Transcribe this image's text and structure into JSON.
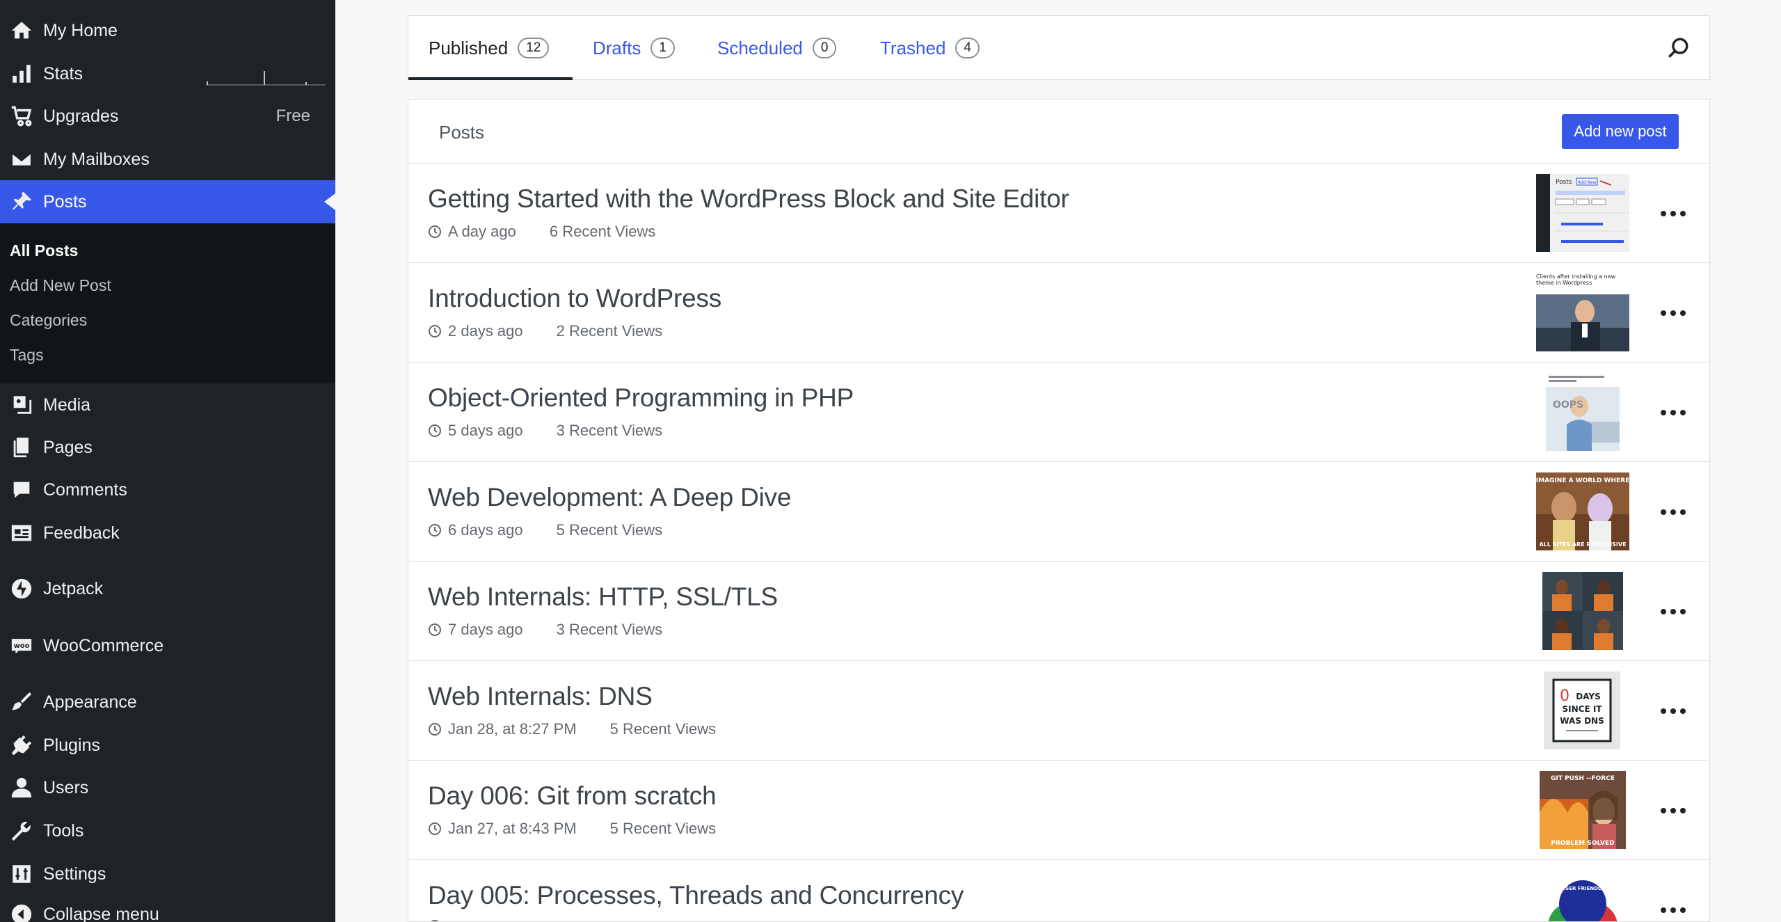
{
  "sidebar": {
    "menu": [
      {
        "label": "My Home",
        "icon": "home-icon"
      },
      {
        "label": "Stats",
        "icon": "stats-icon"
      },
      {
        "label": "Upgrades",
        "icon": "cart-icon",
        "badge": "Free"
      },
      {
        "label": "My Mailboxes",
        "icon": "mail-icon"
      },
      {
        "label": "Posts",
        "icon": "pushpin-icon"
      },
      {
        "label": "Media",
        "icon": "media-icon"
      },
      {
        "label": "Pages",
        "icon": "pages-icon"
      },
      {
        "label": "Comments",
        "icon": "comment-icon"
      },
      {
        "label": "Feedback",
        "icon": "feedback-icon"
      },
      {
        "label": "Jetpack",
        "icon": "jetpack-icon"
      },
      {
        "label": "WooCommerce",
        "icon": "woo-icon"
      },
      {
        "label": "Appearance",
        "icon": "brush-icon"
      },
      {
        "label": "Plugins",
        "icon": "plugin-icon"
      },
      {
        "label": "Users",
        "icon": "user-icon"
      },
      {
        "label": "Tools",
        "icon": "wrench-icon"
      },
      {
        "label": "Settings",
        "icon": "settings-icon"
      },
      {
        "label": "Collapse menu",
        "icon": "collapse-icon"
      }
    ],
    "submenu": [
      "All Posts",
      "Add New Post",
      "Categories",
      "Tags"
    ]
  },
  "tabs": [
    {
      "label": "Published",
      "count": "12"
    },
    {
      "label": "Drafts",
      "count": "1"
    },
    {
      "label": "Scheduled",
      "count": "0"
    },
    {
      "label": "Trashed",
      "count": "4"
    }
  ],
  "list": {
    "header": "Posts",
    "add_button": "Add new post"
  },
  "posts": [
    {
      "title": "Getting Started with the WordPress Block and Site Editor",
      "date": "A day ago",
      "views": "6 Recent Views",
      "thumb": "screenshot"
    },
    {
      "title": "Introduction to WordPress",
      "date": "2 days ago",
      "views": "2 Recent Views",
      "thumb": "meme-man"
    },
    {
      "title": "Object-Oriented Programming in PHP",
      "date": "5 days ago",
      "views": "3 Recent Views",
      "thumb": "oops-meme"
    },
    {
      "title": "Web Development: A Deep Dive",
      "date": "6 days ago",
      "views": "5 Recent Views",
      "thumb": "toy-meme"
    },
    {
      "title": "Web Internals: HTTP, SSL/TLS",
      "date": "7 days ago",
      "views": "3 Recent Views",
      "thumb": "prison-meme"
    },
    {
      "title": "Web Internals: DNS",
      "date": "Jan 28, at 8:27 PM",
      "views": "5 Recent Views",
      "thumb": "dns-sign"
    },
    {
      "title": "Day 006: Git from scratch",
      "date": "Jan 27, at 8:43 PM",
      "views": "5 Recent Views",
      "thumb": "fire-girl"
    },
    {
      "title": "Day 005: Processes, Threads and Concurrency",
      "date": "",
      "views": "",
      "thumb": "venn"
    }
  ],
  "thumb_text": {
    "screenshot": {
      "a": "Posts",
      "b": "Add New"
    },
    "meme_man": "Clients after installing a new theme in Wordpress",
    "oops": "OOPS",
    "toy_top": "IMAGINE A WORLD WHERE",
    "toy_bottom": "ALL SITES ARE RESPONSIVE",
    "dns_num": "0",
    "dns_line1": "DAYS",
    "dns_line2": "SINCE IT",
    "dns_line3": "WAS DNS",
    "git_top": "GIT PUSH --FORCE",
    "git_bottom": "PROBLEM SOLVED",
    "venn_top": "USER FRIENDLY"
  },
  "colors": {
    "sidebar_bg": "#1d2327",
    "accent": "#3858e9",
    "page_bg": "#f6f7f7"
  }
}
